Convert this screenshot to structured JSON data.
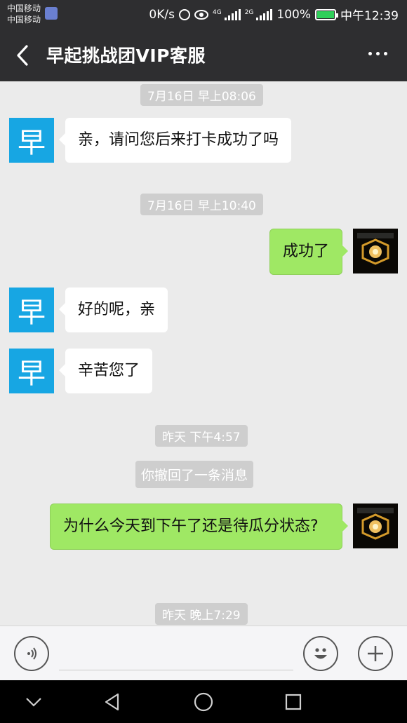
{
  "status_bar": {
    "carrier_1": "中国移动",
    "carrier_2": "中国移动",
    "net_speed": "0K/s",
    "sim1_tag": "4G",
    "sim2_tag": "2G",
    "battery_text": "100%",
    "battery_level": 1.0,
    "time": "中午12:39",
    "icons": [
      "alarm-icon",
      "eye-icon",
      "signal-icon",
      "battery-icon"
    ]
  },
  "header": {
    "title": "早起挑战团VIP客服",
    "back_icon": "chevron-left-icon",
    "more_icon": "more-dots-icon"
  },
  "contact": {
    "avatar_char": "早",
    "avatar_color": "#17a6e3"
  },
  "chat": {
    "messages": [
      {
        "type": "time",
        "text": "7月16日 早上08:06"
      },
      {
        "type": "in",
        "text": "亲，请问您后来打卡成功了吗"
      },
      {
        "type": "time",
        "text": "7月16日 早上10:40"
      },
      {
        "type": "out",
        "text": "成功了"
      },
      {
        "type": "in",
        "text": "好的呢，亲"
      },
      {
        "type": "in",
        "text": "辛苦您了"
      },
      {
        "type": "time",
        "text": "昨天 下午4:57"
      },
      {
        "type": "system",
        "text": "你撤回了一条消息"
      },
      {
        "type": "out",
        "text": "为什么今天到下午了还是待瓜分状态?"
      },
      {
        "type": "time",
        "text": "昨天 晚上7:29"
      }
    ]
  },
  "input_bar": {
    "voice_icon": "voice-icon",
    "emoji_icon": "smiley-icon",
    "plus_icon": "plus-icon"
  },
  "nav_bar": {
    "icons": [
      "chevron-down-icon",
      "back-triangle-icon",
      "home-circle-icon",
      "recents-square-icon"
    ]
  },
  "colors": {
    "bar_bg": "#2e2e30",
    "chat_bg": "#ebebeb",
    "out_bubble": "#9fe864",
    "in_bubble": "#ffffff",
    "timestamp_bg": "#cecece"
  }
}
